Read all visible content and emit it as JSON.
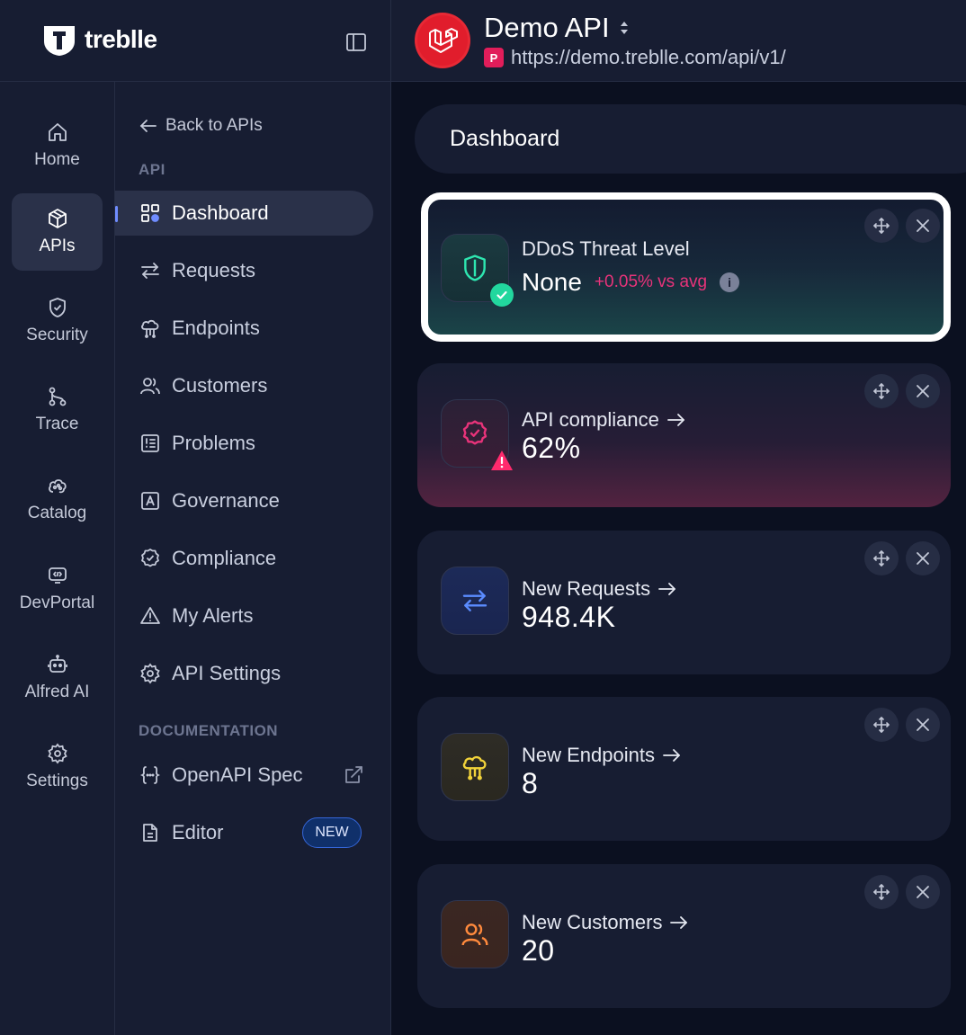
{
  "brand": {
    "name": "treblle"
  },
  "api": {
    "name": "Demo API",
    "badge": "P",
    "url": "https://demo.treblle.com/api/v1/"
  },
  "rail": {
    "items": [
      {
        "label": "Home",
        "icon": "home-icon"
      },
      {
        "label": "APIs",
        "icon": "cube-icon",
        "active": true
      },
      {
        "label": "Security",
        "icon": "shield-icon"
      },
      {
        "label": "Trace",
        "icon": "branch-icon"
      },
      {
        "label": "Catalog",
        "icon": "catalog-icon"
      },
      {
        "label": "DevPortal",
        "icon": "devportal-icon"
      },
      {
        "label": "Alfred AI",
        "icon": "robot-icon"
      },
      {
        "label": "Settings",
        "icon": "gear-icon"
      }
    ]
  },
  "subnav": {
    "back_label": "Back to APIs",
    "api_section": "API",
    "items": [
      {
        "label": "Dashboard",
        "icon": "grid-icon",
        "active": true
      },
      {
        "label": "Requests",
        "icon": "arrows-icon"
      },
      {
        "label": "Endpoints",
        "icon": "cloud-network-icon"
      },
      {
        "label": "Customers",
        "icon": "users-icon"
      },
      {
        "label": "Problems",
        "icon": "list-alert-icon"
      },
      {
        "label": "Governance",
        "icon": "letter-a-icon"
      },
      {
        "label": "Compliance",
        "icon": "award-icon"
      },
      {
        "label": "My Alerts",
        "icon": "warning-icon"
      },
      {
        "label": "API Settings",
        "icon": "gear-icon"
      }
    ],
    "docs_section": "DOCUMENTATION",
    "docs": [
      {
        "label": "OpenAPI Spec",
        "icon": "braces-icon",
        "external": true
      },
      {
        "label": "Editor",
        "icon": "document-icon",
        "badge": "NEW"
      }
    ]
  },
  "page": {
    "title": "Dashboard"
  },
  "cards": {
    "ddos": {
      "title": "DDoS Threat Level",
      "value": "None",
      "delta": "+0.05% vs avg",
      "info": "i"
    },
    "compliance": {
      "title": "API compliance",
      "value": "62%"
    },
    "requests": {
      "title": "New Requests",
      "value": "948.4K"
    },
    "endpoints": {
      "title": "New Endpoints",
      "value": "8"
    },
    "customers": {
      "title": "New Customers",
      "value": "20"
    }
  },
  "colors": {
    "background": "#0b1020",
    "panel": "#171d32",
    "accent": "#6f8cff",
    "ddos": "#2ee6b0",
    "compliance": "#e8337a",
    "requests": "#5b8cff",
    "endpoints": "#f2d33a",
    "customers": "#ff8a3d"
  }
}
